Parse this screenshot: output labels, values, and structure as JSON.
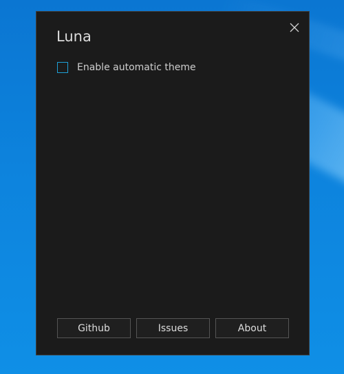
{
  "window": {
    "title": "Luna",
    "close_icon": "close-icon"
  },
  "settings": {
    "auto_theme_label": "Enable automatic theme",
    "auto_theme_checked": false
  },
  "footer": {
    "buttons": [
      {
        "label": "Github"
      },
      {
        "label": "Issues"
      },
      {
        "label": "About"
      }
    ]
  },
  "colors": {
    "window_bg": "#1b1b1b",
    "accent": "#1ea1d8",
    "desktop_bg": "#0a78d4"
  }
}
